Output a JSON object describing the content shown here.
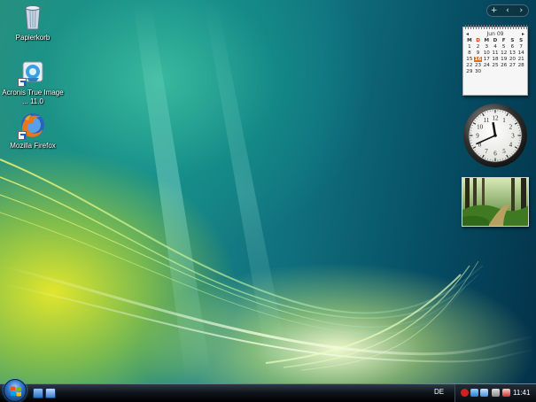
{
  "desktop_icons": [
    {
      "label": "Papierkorb",
      "icon": "recycle-bin-icon"
    },
    {
      "label": "Acronis True Image ... 11.0",
      "icon": "acronis-icon"
    },
    {
      "label": "Mozilla Firefox",
      "icon": "firefox-icon"
    }
  ],
  "sidebar": {
    "add_label": "+",
    "prev_label": "‹",
    "next_label": "›"
  },
  "calendar": {
    "month_label": "Jun 09",
    "weekdays": [
      "M",
      "D",
      "M",
      "D",
      "F",
      "S",
      "S"
    ],
    "days": [
      1,
      2,
      3,
      4,
      5,
      6,
      7,
      8,
      9,
      10,
      11,
      12,
      13,
      14,
      15,
      16,
      17,
      18,
      19,
      20,
      21,
      22,
      23,
      24,
      25,
      26,
      27,
      28,
      29,
      30
    ],
    "today": 16,
    "sunday_color": "#d03010",
    "today_color": "#e86a10"
  },
  "analog_clock": {
    "numerals": [
      "12",
      "1",
      "2",
      "3",
      "4",
      "5",
      "6",
      "7",
      "8",
      "9",
      "10",
      "11"
    ],
    "hour": 11,
    "minute": 41
  },
  "slideshow": {
    "subject": "forest path"
  },
  "taskbar": {
    "language": "DE",
    "time": "11:41",
    "quick_launch": [
      "show-desktop-icon",
      "switch-windows-icon"
    ],
    "tray_icons": [
      "antivirus-icon",
      "safely-remove-icon",
      "network-icon",
      "volume-icon",
      "power-icon"
    ]
  }
}
